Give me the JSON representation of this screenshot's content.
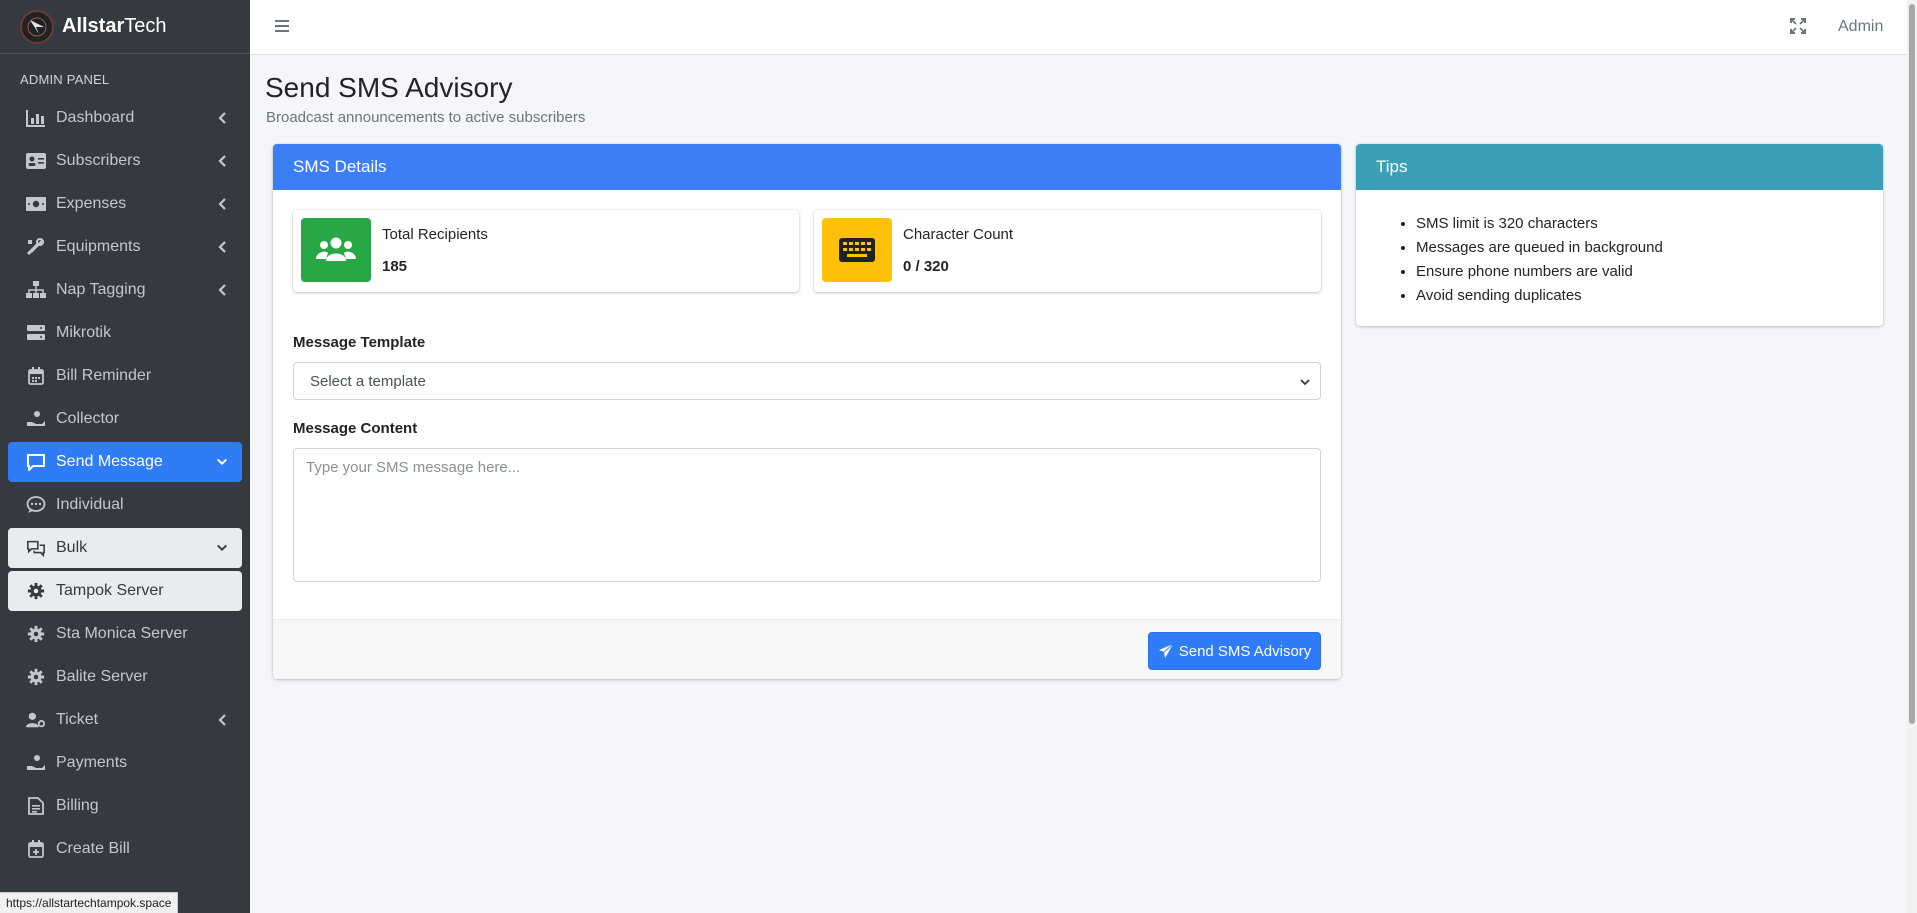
{
  "brand": {
    "name_bold": "Allstar",
    "name_rest": "Tech"
  },
  "sidebar": {
    "header": "ADMIN PANEL",
    "items": [
      {
        "label": "Dashboard",
        "icon": "chart-bar-icon",
        "chevron": true
      },
      {
        "label": "Subscribers",
        "icon": "address-card-icon",
        "chevron": true
      },
      {
        "label": "Expenses",
        "icon": "money-bill-icon",
        "chevron": true
      },
      {
        "label": "Equipments",
        "icon": "tools-icon",
        "chevron": true
      },
      {
        "label": "Nap Tagging",
        "icon": "sitemap-icon",
        "chevron": true
      },
      {
        "label": "Mikrotik",
        "icon": "server-icon",
        "chevron": false
      },
      {
        "label": "Bill Reminder",
        "icon": "calendar-icon",
        "chevron": false
      },
      {
        "label": "Collector",
        "icon": "hand-coin-icon",
        "chevron": false
      },
      {
        "label": "Send Message",
        "icon": "message-icon",
        "chevron": true,
        "state": "active"
      },
      {
        "label": "Individual",
        "icon": "comment-dots-icon",
        "chevron": false
      },
      {
        "label": "Bulk",
        "icon": "comments-icon",
        "chevron": true,
        "state": "open"
      },
      {
        "label": "Tampok Server",
        "icon": "gear-icon",
        "chevron": false,
        "state": "open"
      },
      {
        "label": "Sta Monica Server",
        "icon": "gear-icon",
        "chevron": false
      },
      {
        "label": "Balite Server",
        "icon": "gear-icon",
        "chevron": false
      },
      {
        "label": "Ticket",
        "icon": "user-gear-icon",
        "chevron": true
      },
      {
        "label": "Payments",
        "icon": "hand-coin-icon",
        "chevron": false
      },
      {
        "label": "Billing",
        "icon": "file-invoice-icon",
        "chevron": false
      },
      {
        "label": "Create Bill",
        "icon": "calendar-plus-icon",
        "chevron": false
      }
    ]
  },
  "status_bar_url": "https://allstartechtampok.space",
  "topbar": {
    "admin_label": "Admin"
  },
  "page": {
    "title": "Send SMS Advisory",
    "subtitle": "Broadcast announcements to active subscribers"
  },
  "sms_card": {
    "header": "SMS Details",
    "recipients": {
      "label": "Total Recipients",
      "value": "185",
      "icon": "users-icon"
    },
    "char_count": {
      "label": "Character Count",
      "value": "0 / 320",
      "icon": "keyboard-icon"
    },
    "template_label": "Message Template",
    "template_selected": "Select a template",
    "content_label": "Message Content",
    "content_placeholder": "Type your SMS message here...",
    "send_button": "Send SMS Advisory"
  },
  "tips_card": {
    "header": "Tips",
    "items": [
      "SMS limit is 320 characters",
      "Messages are queued in background",
      "Ensure phone numbers are valid",
      "Avoid sending duplicates"
    ]
  },
  "colors": {
    "sidebar_bg": "#343a40",
    "primary": "#2f7cf6",
    "info": "#3ba0b5",
    "success": "#28a745",
    "warning": "#ffc107"
  }
}
